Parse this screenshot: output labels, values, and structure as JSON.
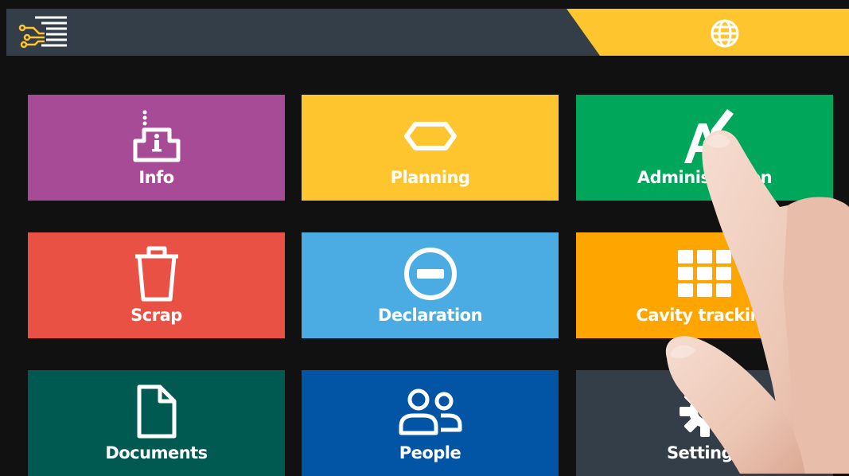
{
  "colors": {
    "background": "#111111",
    "topbar": "#333e48",
    "accent": "#fec52e"
  },
  "header": {
    "menu_icon": "circuit-menu-icon",
    "language_icon": "globe-icon"
  },
  "tiles": [
    {
      "label": "Info",
      "icon": "info-podium-icon",
      "color": "#a84b97"
    },
    {
      "label": "Planning",
      "icon": "hexagon-icon",
      "color": "#fec52e"
    },
    {
      "label": "Administration",
      "icon": "text-edit-icon",
      "color": "#00a65a"
    },
    {
      "label": "Scrap",
      "icon": "trash-icon",
      "color": "#e95144"
    },
    {
      "label": "Declaration",
      "icon": "minus-circle-icon",
      "color": "#4aace2"
    },
    {
      "label": "Cavity tracking",
      "icon": "grid-icon",
      "color": "#fea500"
    },
    {
      "label": "Documents",
      "icon": "document-icon",
      "color": "#005a52"
    },
    {
      "label": "People",
      "icon": "people-icon",
      "color": "#0254a5"
    },
    {
      "label": "Settings",
      "icon": "gear-icon",
      "color": "#333e48"
    }
  ]
}
